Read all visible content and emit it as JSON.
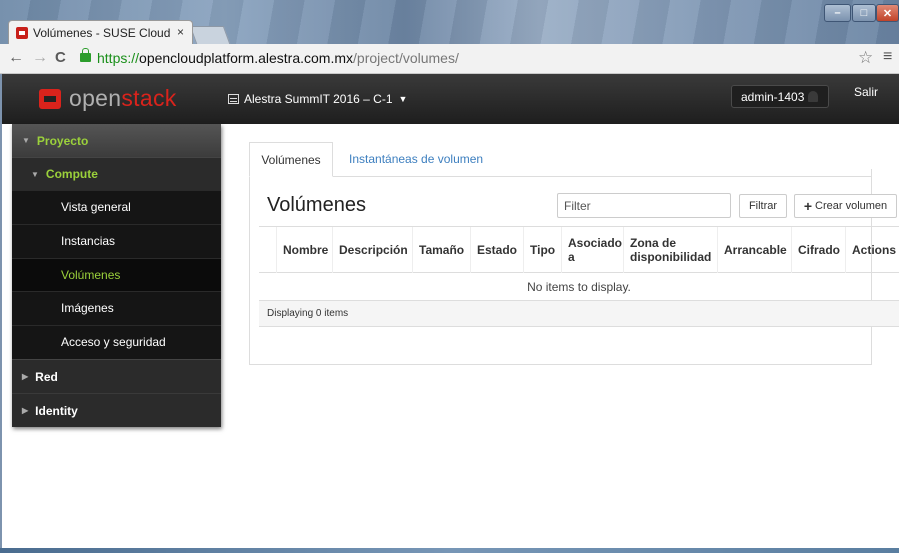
{
  "browser": {
    "tab_title": "Volúmenes - SUSE Cloud",
    "close_glyph": "×",
    "url_scheme": "https://",
    "url_host": "opencloudplatform.alestra.com.mx",
    "url_path": "/project/volumes/"
  },
  "header": {
    "logo_part1": "open",
    "logo_part2": "stack",
    "project_selector": "Alestra SummIT 2016 – C-1",
    "user": "admin-1403",
    "logout": "Salir"
  },
  "sidebar": {
    "project": "Proyecto",
    "compute": "Compute",
    "items": [
      {
        "label": "Vista general"
      },
      {
        "label": "Instancias"
      },
      {
        "label": "Volúmenes"
      },
      {
        "label": "Imágenes"
      },
      {
        "label": "Acceso y seguridad"
      }
    ],
    "red": "Red",
    "identity": "Identity"
  },
  "main": {
    "tabs": [
      {
        "label": "Volúmenes"
      },
      {
        "label": "Instantáneas de volumen"
      }
    ],
    "title": "Volúmenes",
    "filter_placeholder": "Filter",
    "filter_button": "Filtrar",
    "create_button": "Crear volumen",
    "columns": [
      "Nombre",
      "Descripción",
      "Tamaño",
      "Estado",
      "Tipo",
      "Asociado a",
      "Zona de disponibilidad",
      "Arrancable",
      "Cifrado",
      "Actions"
    ],
    "empty_message": "No items to display.",
    "footer": "Displaying 0 items"
  },
  "colors": {
    "accent_green": "#9bd13b",
    "brand_red": "#d9231c",
    "link_blue": "#3d7fbf"
  }
}
